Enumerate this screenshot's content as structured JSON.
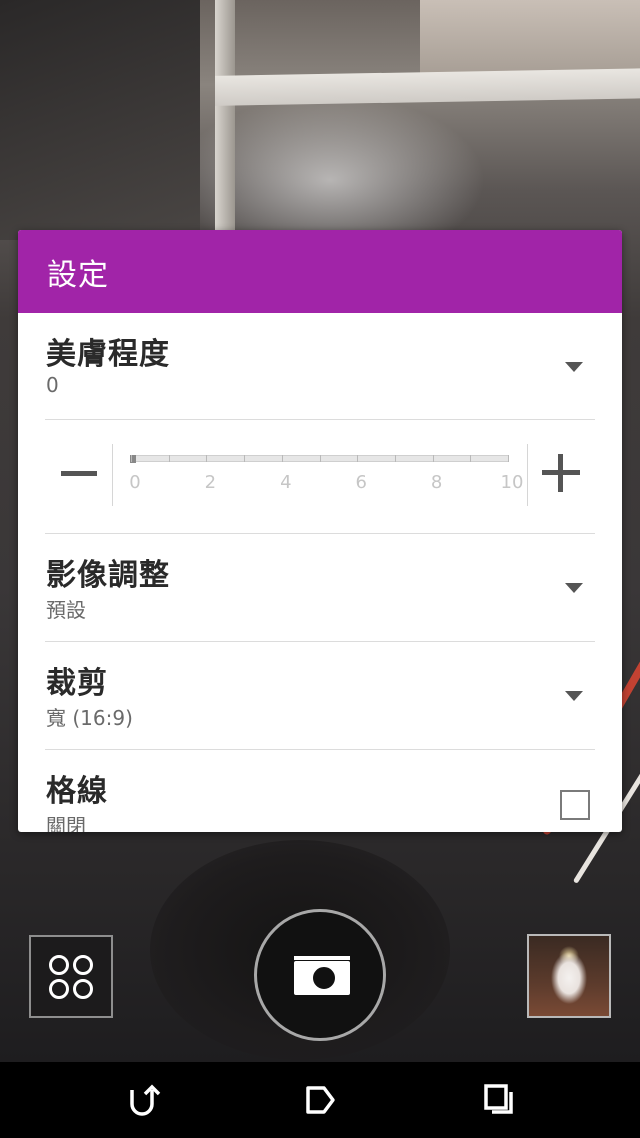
{
  "dialog": {
    "title": "設定"
  },
  "settings": {
    "beauty": {
      "label": "美膚程度",
      "value": "0"
    },
    "slider": {
      "value": 0,
      "min": 0,
      "max": 10,
      "tick_labels": [
        "0",
        "2",
        "4",
        "6",
        "8",
        "10"
      ]
    },
    "image_adjust": {
      "label": "影像調整",
      "value": "預設"
    },
    "crop": {
      "label": "裁剪",
      "value": "寬 (16:9)"
    },
    "grid": {
      "label": "格線",
      "value": "關閉",
      "checked": false
    }
  },
  "icons": {
    "minus": "minus-icon",
    "plus": "plus-icon",
    "dropdown": "triangle-down-icon",
    "grid_mode": "four-circles-icon",
    "shutter": "camera-icon",
    "nav_back": "back-arrow-icon",
    "nav_home": "home-tag-icon",
    "nav_recents": "recent-apps-icon"
  },
  "colors": {
    "header": "#a124a8",
    "panel": "#ffffff",
    "navbar": "#000000"
  }
}
